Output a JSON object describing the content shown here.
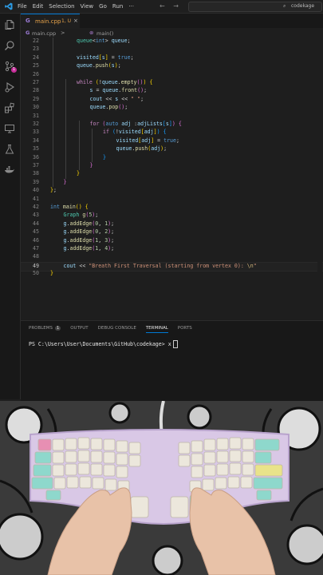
{
  "titlebar": {
    "menu": [
      "File",
      "Edit",
      "Selection",
      "View",
      "Go",
      "Run",
      "···"
    ],
    "search_text": "codekage"
  },
  "tab": {
    "filename": "main.cpp",
    "status": "1, U",
    "close": "×"
  },
  "breadcrumb": {
    "file": "main.cpp",
    "separator": ">",
    "symbol": "main()"
  },
  "editor": {
    "active_line": 49,
    "lines": [
      {
        "n": 22,
        "indent": 2,
        "tokens": [
          [
            "typ",
            "queue"
          ],
          [
            "",
            "<"
          ],
          [
            "kw",
            "int"
          ],
          [
            "",
            "> "
          ],
          [
            "var",
            "queue"
          ],
          [
            "",
            ";"
          ]
        ]
      },
      {
        "n": 23,
        "indent": 0,
        "tokens": []
      },
      {
        "n": 24,
        "indent": 2,
        "tokens": [
          [
            "var",
            "visited"
          ],
          [
            "br1",
            "["
          ],
          [
            "var",
            "s"
          ],
          [
            "br1",
            "]"
          ],
          [
            "",
            " = "
          ],
          [
            "kw",
            "true"
          ],
          [
            "",
            ";"
          ]
        ]
      },
      {
        "n": 25,
        "indent": 2,
        "tokens": [
          [
            "var",
            "queue"
          ],
          [
            "",
            "."
          ],
          [
            "fn",
            "push"
          ],
          [
            "br1",
            "("
          ],
          [
            "var",
            "s"
          ],
          [
            "br1",
            ")"
          ],
          [
            "",
            ";"
          ]
        ]
      },
      {
        "n": 26,
        "indent": 0,
        "tokens": []
      },
      {
        "n": 27,
        "indent": 2,
        "tokens": [
          [
            "ctl",
            "while"
          ],
          [
            "",
            " "
          ],
          [
            "br1",
            "("
          ],
          [
            "",
            "!"
          ],
          [
            "var",
            "queue"
          ],
          [
            "",
            "."
          ],
          [
            "fn",
            "empty"
          ],
          [
            "br2",
            "()"
          ],
          [
            "br1",
            ")"
          ],
          [
            "",
            " "
          ],
          [
            "br1",
            "{"
          ]
        ]
      },
      {
        "n": 28,
        "indent": 3,
        "tokens": [
          [
            "var",
            "s"
          ],
          [
            "",
            " = "
          ],
          [
            "var",
            "queue"
          ],
          [
            "",
            "."
          ],
          [
            "fn",
            "front"
          ],
          [
            "br2",
            "()"
          ],
          [
            "",
            ";"
          ]
        ]
      },
      {
        "n": 29,
        "indent": 3,
        "tokens": [
          [
            "var",
            "cout"
          ],
          [
            "",
            " << "
          ],
          [
            "var",
            "s"
          ],
          [
            "",
            " << "
          ],
          [
            "str",
            "\" \""
          ],
          [
            "",
            ";"
          ]
        ]
      },
      {
        "n": 30,
        "indent": 3,
        "tokens": [
          [
            "var",
            "queue"
          ],
          [
            "",
            "."
          ],
          [
            "fn",
            "pop"
          ],
          [
            "br2",
            "()"
          ],
          [
            "",
            ";"
          ]
        ]
      },
      {
        "n": 31,
        "indent": 0,
        "tokens": []
      },
      {
        "n": 32,
        "indent": 3,
        "tokens": [
          [
            "ctl",
            "for"
          ],
          [
            "",
            " "
          ],
          [
            "br2",
            "("
          ],
          [
            "kw",
            "auto"
          ],
          [
            "",
            " "
          ],
          [
            "var",
            "adj"
          ],
          [
            "",
            " :"
          ],
          [
            "var",
            "adjLists"
          ],
          [
            "br3",
            "["
          ],
          [
            "var",
            "s"
          ],
          [
            "br3",
            "]"
          ],
          [
            "br2",
            ")"
          ],
          [
            "",
            " "
          ],
          [
            "br2",
            "{"
          ]
        ]
      },
      {
        "n": 33,
        "indent": 4,
        "tokens": [
          [
            "ctl",
            "if"
          ],
          [
            "",
            " "
          ],
          [
            "br3",
            "("
          ],
          [
            "",
            "!"
          ],
          [
            "var",
            "visited"
          ],
          [
            "br1",
            "["
          ],
          [
            "var",
            "adj"
          ],
          [
            "br1",
            "]"
          ],
          [
            "br3",
            ")"
          ],
          [
            "",
            " "
          ],
          [
            "br3",
            "{"
          ]
        ]
      },
      {
        "n": 34,
        "indent": 5,
        "tokens": [
          [
            "var",
            "visited"
          ],
          [
            "br1",
            "["
          ],
          [
            "var",
            "adj"
          ],
          [
            "br1",
            "]"
          ],
          [
            "",
            " = "
          ],
          [
            "kw",
            "true"
          ],
          [
            "",
            ";"
          ]
        ]
      },
      {
        "n": 35,
        "indent": 5,
        "tokens": [
          [
            "var",
            "queue"
          ],
          [
            "",
            "."
          ],
          [
            "fn",
            "push"
          ],
          [
            "br1",
            "("
          ],
          [
            "var",
            "adj"
          ],
          [
            "br1",
            ")"
          ],
          [
            "",
            ";"
          ]
        ]
      },
      {
        "n": 36,
        "indent": 4,
        "tokens": [
          [
            "br3",
            "}"
          ]
        ]
      },
      {
        "n": 37,
        "indent": 3,
        "tokens": [
          [
            "br2",
            "}"
          ]
        ]
      },
      {
        "n": 38,
        "indent": 2,
        "tokens": [
          [
            "br1",
            "}"
          ]
        ]
      },
      {
        "n": 39,
        "indent": 1,
        "tokens": [
          [
            "br2",
            "}"
          ]
        ]
      },
      {
        "n": 40,
        "indent": 0,
        "tokens": [
          [
            "br1",
            "}"
          ],
          [
            "",
            ";"
          ]
        ]
      },
      {
        "n": 41,
        "indent": 0,
        "tokens": []
      },
      {
        "n": 42,
        "indent": 0,
        "tokens": [
          [
            "kw",
            "int"
          ],
          [
            "",
            " "
          ],
          [
            "fn",
            "main"
          ],
          [
            "br1",
            "()"
          ],
          [
            "",
            " "
          ],
          [
            "br1",
            "{"
          ]
        ]
      },
      {
        "n": 43,
        "indent": 1,
        "tokens": [
          [
            "typ",
            "Graph"
          ],
          [
            "",
            " "
          ],
          [
            "fn",
            "g"
          ],
          [
            "br2",
            "("
          ],
          [
            "num2",
            "5"
          ],
          [
            "br2",
            ")"
          ],
          [
            "",
            ";"
          ]
        ]
      },
      {
        "n": 44,
        "indent": 1,
        "tokens": [
          [
            "var",
            "g"
          ],
          [
            "",
            "."
          ],
          [
            "fn",
            "addEdge"
          ],
          [
            "br2",
            "("
          ],
          [
            "num2",
            "0"
          ],
          [
            "",
            ", "
          ],
          [
            "num2",
            "1"
          ],
          [
            "br2",
            ")"
          ],
          [
            "",
            ";"
          ]
        ]
      },
      {
        "n": 45,
        "indent": 1,
        "tokens": [
          [
            "var",
            "g"
          ],
          [
            "",
            "."
          ],
          [
            "fn",
            "addEdge"
          ],
          [
            "br2",
            "("
          ],
          [
            "num2",
            "0"
          ],
          [
            "",
            ", "
          ],
          [
            "num2",
            "2"
          ],
          [
            "br2",
            ")"
          ],
          [
            "",
            ";"
          ]
        ]
      },
      {
        "n": 46,
        "indent": 1,
        "tokens": [
          [
            "var",
            "g"
          ],
          [
            "",
            "."
          ],
          [
            "fn",
            "addEdge"
          ],
          [
            "br2",
            "("
          ],
          [
            "num2",
            "1"
          ],
          [
            "",
            ", "
          ],
          [
            "num2",
            "3"
          ],
          [
            "br2",
            ")"
          ],
          [
            "",
            ";"
          ]
        ]
      },
      {
        "n": 47,
        "indent": 1,
        "tokens": [
          [
            "var",
            "g"
          ],
          [
            "",
            "."
          ],
          [
            "fn",
            "addEdge"
          ],
          [
            "br2",
            "("
          ],
          [
            "num2",
            "1"
          ],
          [
            "",
            ", "
          ],
          [
            "num2",
            "4"
          ],
          [
            "br2",
            ")"
          ],
          [
            "",
            ";"
          ]
        ]
      },
      {
        "n": 48,
        "indent": 0,
        "tokens": []
      },
      {
        "n": 49,
        "indent": 1,
        "tokens": [
          [
            "var",
            "cout"
          ],
          [
            "",
            " << "
          ],
          [
            "str",
            "\"Breath First Traversal (starting from vertex 0): "
          ],
          [
            "esc",
            "\\n"
          ],
          [
            "str",
            "\""
          ]
        ]
      },
      {
        "n": 50,
        "indent": 0,
        "tokens": [
          [
            "br1",
            "}"
          ]
        ]
      }
    ]
  },
  "panel": {
    "tabs": [
      "PROBLEMS",
      "OUTPUT",
      "DEBUG CONSOLE",
      "TERMINAL",
      "PORTS"
    ],
    "problems_count": "1",
    "active_tab": "TERMINAL",
    "prompt": "PS C:\\Users\\User\\Documents\\GitHub\\codekage>",
    "typed": "x"
  },
  "colors": {
    "accent": "#0078d4",
    "badge": "#c72e9a",
    "modified": "#e8a34a"
  }
}
